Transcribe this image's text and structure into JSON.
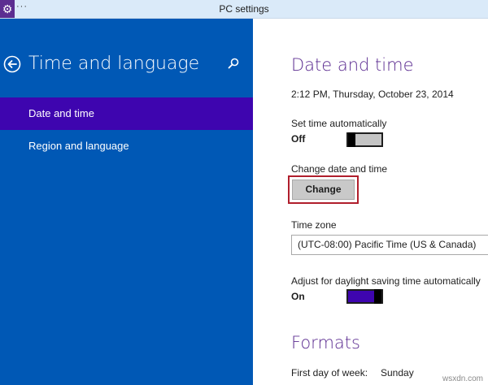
{
  "window": {
    "title": "PC settings",
    "menu_glyph": "···",
    "app_icon": "gear-icon"
  },
  "sidebar": {
    "title": "Time and language",
    "items": [
      {
        "label": "Date and time",
        "active": true
      },
      {
        "label": "Region and language",
        "active": false
      }
    ],
    "accent": "#0058b5",
    "active_color": "#3e05af"
  },
  "content": {
    "heading": "Date and time",
    "current_datetime": "2:12 PM, Thursday, October 23, 2014",
    "set_time_auto": {
      "label": "Set time automatically",
      "state": "Off"
    },
    "change": {
      "label": "Change date and time",
      "button": "Change"
    },
    "time_zone": {
      "label": "Time zone",
      "value": "(UTC-08:00) Pacific Time (US & Canada)"
    },
    "dst": {
      "label": "Adjust for daylight saving time automatically",
      "state": "On"
    },
    "formats": {
      "heading": "Formats",
      "first_day_label": "First day of week:",
      "first_day_value": "Sunday"
    },
    "heading_color": "#5c2d91"
  },
  "watermark": "wsxdn.com"
}
